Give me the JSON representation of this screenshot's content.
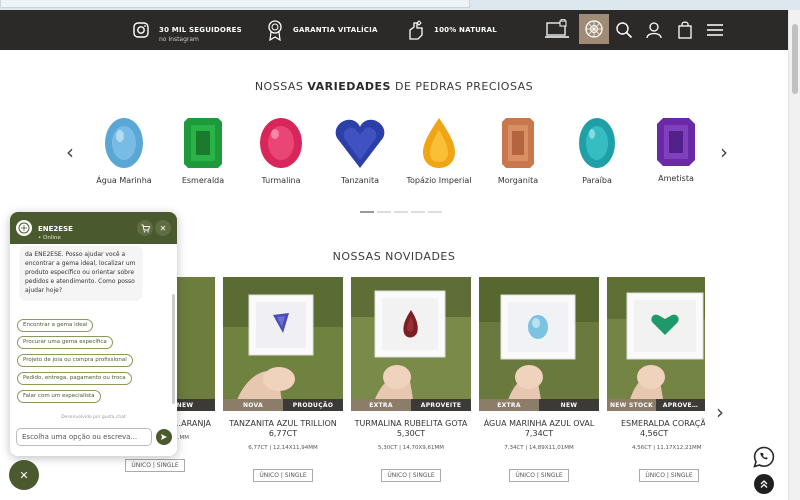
{
  "header": {
    "followers_label": "30 MIL SEGUIDORES",
    "followers_sub": "no Instagram",
    "warranty_label": "GARANTIA VITALÍCIA",
    "natural_label": "100% NATURAL"
  },
  "gems_section": {
    "title_pre": "NOSSAS",
    "title_bold": "VARIEDADES",
    "title_post": "DE PEDRAS PRECIOSAS",
    "gems": [
      {
        "name": "Água Marinha",
        "color": "#5aa7d6"
      },
      {
        "name": "Esmeralda",
        "color": "#1f9a3a"
      },
      {
        "name": "Turmalina",
        "color": "#d8265a"
      },
      {
        "name": "Tanzanita",
        "color": "#2b3fa8"
      },
      {
        "name": "Topázio Imperial",
        "color": "#f0a514"
      },
      {
        "name": "Morganita",
        "color": "#c9784e"
      },
      {
        "name": "Paraíba",
        "color": "#1fa0a8"
      },
      {
        "name": "Ametista",
        "color": "#6a2aa8"
      }
    ]
  },
  "news_section": {
    "title": "NOSSAS NOVIDADES",
    "products": [
      {
        "name": "…ARANJA",
        "meta": "…MM",
        "tag1": "",
        "tag2": "NEW",
        "stone_color": "#e07a2a",
        "button": "ÚNICO | SINGLE"
      },
      {
        "name": "TANZANITA AZUL TRILLION",
        "name2": "6,77CT",
        "meta": "6,77CT | 12,14X11,94MM",
        "tag1": "NOVA",
        "tag2": "PRODUÇÃO",
        "stone_color": "#4a4cb8",
        "button": "ÚNICO | SINGLE"
      },
      {
        "name": "TURMALINA RUBELITA GOTA",
        "name2": "5,30CT",
        "meta": "5,30CT | 14,70X9,61MM",
        "tag1": "EXTRA",
        "tag2": "APROVEITE",
        "stone_color": "#7a1f25",
        "button": "ÚNICO | SINGLE"
      },
      {
        "name": "ÁGUA MARINHA AZUL OVAL",
        "name2": "7,34CT",
        "meta": "7,34CT | 14,89X11,01MM",
        "tag1": "EXTRA",
        "tag2": "NEW",
        "stone_color": "#7cc3e2",
        "button": "ÚNICO | SINGLE"
      },
      {
        "name": "ESMERALDA CORAÇÃ…",
        "name2": "4,56CT",
        "meta": "4,56CT | 11,17X12,21MM",
        "tag1": "NEW STOCK",
        "tag2": "APROVE…",
        "stone_color": "#1e9a6a",
        "button": "ÚNICO | SINGLE"
      }
    ]
  },
  "chat": {
    "title": "ENE2ESE",
    "status": "• Online",
    "message": "da ENE2ESE. Posso ajudar você a encontrar a gema ideal, localizar um produto específico ou orientar sobre pedidos e atendimento. Como posso ajudar hoje?",
    "options": [
      "Encontrar a gema ideal",
      "Procurar uma gema específica",
      "Projeto de joia ou compra profissional",
      "Pedido, entrega, pagamento ou troca",
      "Falar com um especialista"
    ],
    "powered": "Desenvolvido por gusta.chat",
    "input_placeholder": "Escolha uma opção ou escreva...",
    "close_label": "✕"
  },
  "colors": {
    "header_bg": "#2b2a28",
    "accent_green": "#4a5a2e",
    "tag_brown": "#8c7c6a"
  }
}
